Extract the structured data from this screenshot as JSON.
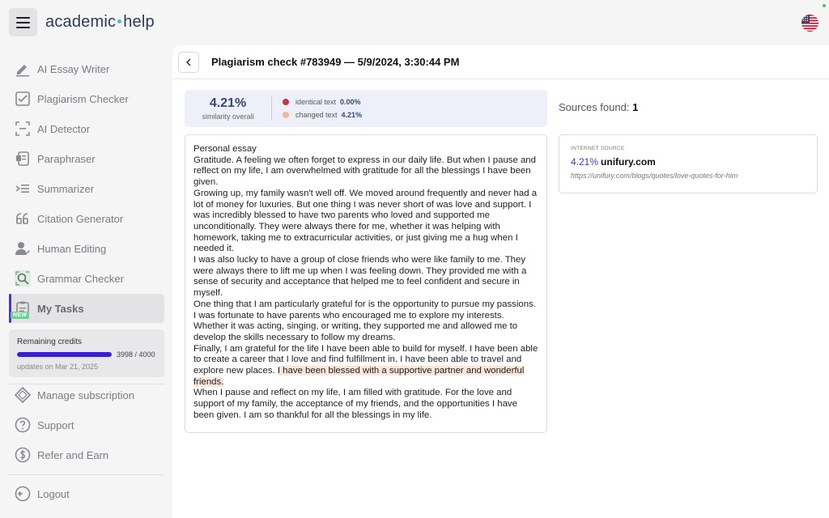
{
  "brand": {
    "part1": "academic",
    "part2": "help",
    "accent": "#3ec7b4"
  },
  "sidebar": {
    "items": [
      {
        "label": "AI Essay Writer",
        "icon": "pen-icon"
      },
      {
        "label": "Plagiarism Checker",
        "icon": "document-check-icon"
      },
      {
        "label": "AI Detector",
        "icon": "scan-icon"
      },
      {
        "label": "Paraphraser",
        "icon": "paraphrase-icon"
      },
      {
        "label": "Summarizer",
        "icon": "summarize-icon"
      },
      {
        "label": "Citation Generator",
        "icon": "quote-icon"
      },
      {
        "label": "Human Editing",
        "icon": "person-edit-icon"
      },
      {
        "label": "Grammar Checker",
        "icon": "grammar-search-icon",
        "badge": "NEW"
      },
      {
        "label": "My Tasks",
        "icon": "tasks-icon",
        "active": true
      }
    ],
    "credits": {
      "label": "Remaining credits",
      "used": 3998,
      "total": 4000,
      "count_text": "3998 / 4000",
      "updates": "updates on Mar 21, 2025",
      "bar_color": "#3b1fd6"
    },
    "bottom_items": [
      {
        "label": "Manage subscription",
        "icon": "diamond-icon"
      },
      {
        "label": "Support",
        "icon": "help-circle-icon"
      },
      {
        "label": "Refer and Earn",
        "icon": "dollar-circle-icon"
      }
    ],
    "logout": {
      "label": "Logout",
      "icon": "logout-icon"
    }
  },
  "header": {
    "title": "Plagiarism check #783949 — 5/9/2024, 3:30:44 PM"
  },
  "similarity": {
    "percent": "4.21%",
    "label": "similarity overall",
    "identical": {
      "label": "identical text",
      "value": "0.00%",
      "color": "#c0394b"
    },
    "changed": {
      "label": "changed text",
      "value": "4.21%",
      "color": "#f0b89a"
    }
  },
  "essay": {
    "paragraphs": [
      {
        "text": "Personal essay"
      },
      {
        "text": "Gratitude. A feeling we often forget to express in our daily life. But when I pause and reflect on my life, I am overwhelmed with gratitude for all the blessings I have been given."
      },
      {
        "text": "Growing up, my family wasn't well off. We moved around frequently and never had a lot of money for luxuries. But one thing I was never short of was love and support. I was incredibly blessed to have two parents who loved and supported me unconditionally. They were always there for me, whether it was helping with homework, taking me to extracurricular activities, or just giving me a hug when I needed it."
      },
      {
        "text": "I was also lucky to have a group of close friends who were like family to me. They were always there to lift me up when I was feeling down. They provided me with a sense of security and acceptance that helped me to feel confident and secure in myself."
      },
      {
        "text": "One thing that I am particularly grateful for is the opportunity to pursue my passions. I was fortunate to have parents who encouraged me to explore my interests. Whether it was acting, singing, or writing, they supported me and allowed me to develop the skills necessary to follow my dreams."
      },
      {
        "text": "Finally, I am grateful for the life I have been able to build for myself. I have been able to create a career that I love and find fulfillment in. I have been able to travel and explore new places. ",
        "highlight": "I have been blessed with a supportive partner and wonderful friends."
      },
      {
        "text": "When I pause and reflect on my life, I am filled with gratitude. For the love and support of my family, the acceptance of my friends, and the opportunities I have been given. I am so thankful for all the blessings in my life."
      }
    ]
  },
  "sources": {
    "label": "Sources found:",
    "count": "1",
    "items": [
      {
        "type": "INTERNET SOURCE",
        "percent": "4.21%",
        "domain": "unifury.com",
        "url": "https://unifury.com/blogs/quotes/love-quotes-for-him"
      }
    ]
  }
}
